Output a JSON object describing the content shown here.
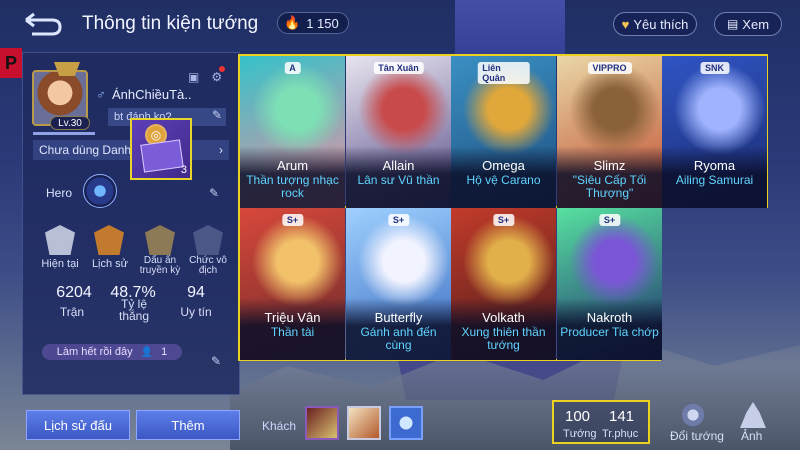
{
  "header": {
    "title": "Thông tin kiện tướng",
    "gems": "1 150",
    "favorite_label": "Yêu thích",
    "view_label": "Xem"
  },
  "profile": {
    "badge": "P",
    "level": "Lv.30",
    "name": "ÁnhChiềuTà..",
    "gender_symbol": "♂",
    "status_text": "bt đánh ko?",
    "title_selector": "Chưa dùng Danh",
    "item_count": "3",
    "hero_label": "Hero"
  },
  "stats": {
    "labels": [
      "Hiện tại",
      "Lịch sử",
      "Dấu ấn truyền kỳ",
      "Chức vô địch"
    ],
    "matches": {
      "value": "6204",
      "label": "Trận"
    },
    "winrate": {
      "value": "48.7%",
      "label": "Tỷ lệ thắng"
    },
    "credit": {
      "value": "94",
      "label": "Uy tín"
    },
    "done_text": "Làm hết rồi đây",
    "done_count": "1"
  },
  "buttons": {
    "history": "Lịch sử đấu",
    "add": "Thêm",
    "guest": "Khách"
  },
  "heroes": [
    {
      "name": "Arum",
      "skin": "Thần tượng nhạc rock",
      "tag": "A",
      "colors": [
        "#35c2c9",
        "#7de0b5",
        "#f08fa0"
      ]
    },
    {
      "name": "Allain",
      "skin": "Lân sư Vũ thần",
      "tag": "Tân Xuân",
      "colors": [
        "#e7e4ef",
        "#c94a4a",
        "#5a4e8a"
      ]
    },
    {
      "name": "Omega",
      "skin": "Hộ vệ Carano",
      "tag": "Liên Quân",
      "colors": [
        "#3b8fc2",
        "#e0a73a",
        "#1d4f80"
      ]
    },
    {
      "name": "Slimz",
      "skin": "\"Siêu Cấp Tối Thượng\"",
      "tag": "VIPPRO",
      "colors": [
        "#e9d7a6",
        "#8a6138",
        "#c04a2f"
      ]
    },
    {
      "name": "Ryoma",
      "skin": "Ailing Samurai",
      "tag": "SNK",
      "colors": [
        "#2f55c4",
        "#9fb4ff",
        "#1b2a6e"
      ]
    },
    {
      "name": "Triệu Vân",
      "skin": "Thần tài",
      "tag": "S+",
      "colors": [
        "#d8483b",
        "#f2c26a",
        "#6a2a2a"
      ]
    },
    {
      "name": "Butterfly",
      "skin": "Gánh anh đến cùng",
      "tag": "S+",
      "colors": [
        "#9fd0ff",
        "#f1f3ff",
        "#3a6bc0"
      ]
    },
    {
      "name": "Volkath",
      "skin": "Xung thiên thần tướng",
      "tag": "S+",
      "colors": [
        "#c23b2a",
        "#e2b04a",
        "#4b1c1c"
      ]
    },
    {
      "name": "Nakroth",
      "skin": "Producer Tia chớp",
      "tag": "S+",
      "colors": [
        "#57e1a0",
        "#7a56d6",
        "#1f2a6e"
      ]
    }
  ],
  "summary": {
    "heroes_count": "100",
    "heroes_label": "Tướng",
    "skins_count": "141",
    "skins_label": "Tr.phục",
    "switch_label": "Đổi tướng",
    "photo_label": "Ảnh"
  }
}
